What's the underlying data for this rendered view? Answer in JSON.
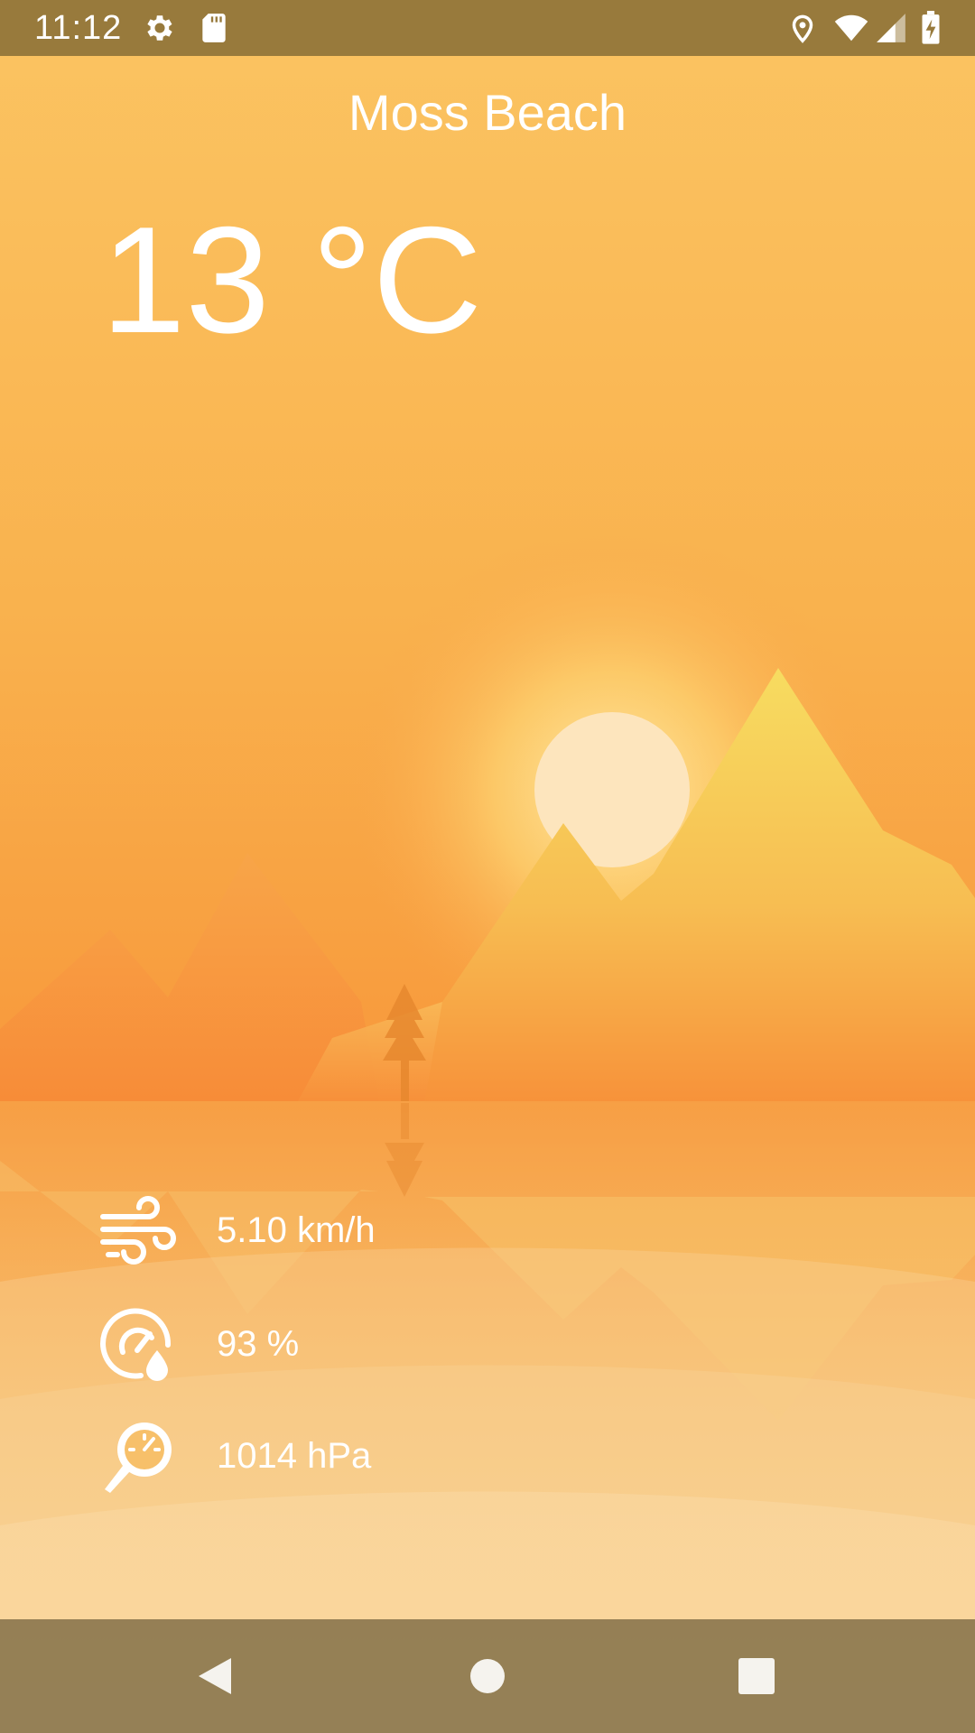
{
  "status_bar": {
    "time": "11:12",
    "icons": [
      "settings-icon",
      "sd-card-icon",
      "location-icon",
      "wifi-icon",
      "cell-signal-icon",
      "battery-charging-icon"
    ]
  },
  "weather": {
    "city": "Moss Beach",
    "temperature": "13 °C"
  },
  "metrics": {
    "wind": {
      "icon": "wind-icon",
      "value": "5.10 km/h"
    },
    "humidity": {
      "icon": "humidity-icon",
      "value": "93 %"
    },
    "pressure": {
      "icon": "pressure-icon",
      "value": "1014 hPa"
    }
  },
  "nav_bar": {
    "buttons": [
      "back-icon",
      "home-icon",
      "recents-icon"
    ]
  },
  "colors": {
    "status_bar_bg": "#987a3c",
    "sky_top": "#fbc462",
    "sky_mid": "#f89b3d",
    "sun": "#fde5bd",
    "mountain_light": "#f7d95e",
    "text": "#ffffff"
  }
}
